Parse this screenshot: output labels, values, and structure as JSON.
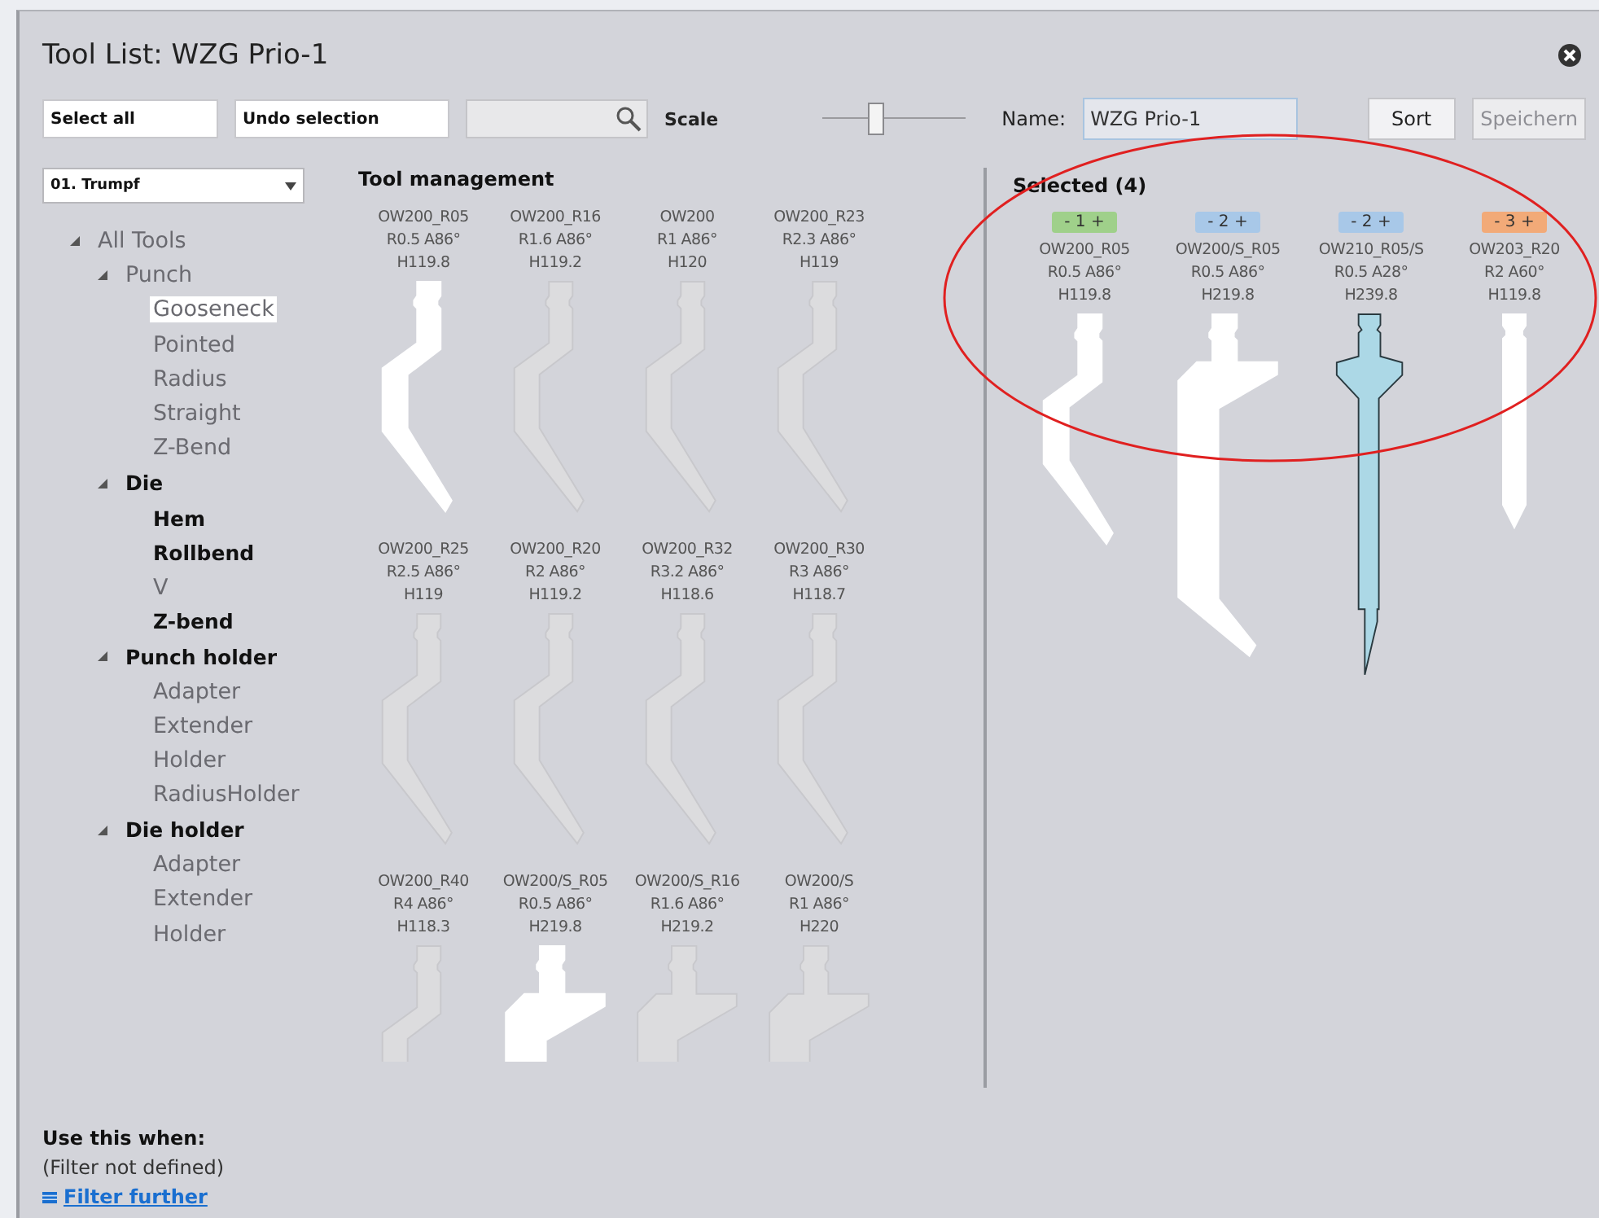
{
  "window": {
    "title": "Tool List: WZG Prio-1"
  },
  "toolbar": {
    "select_all": "Select all",
    "undo_selection": "Undo selection",
    "scale_label": "Scale",
    "scale": {
      "level": 0.37
    },
    "name_label": "Name:",
    "name_value": "WZG Prio-1",
    "sort": {
      "label": "Sort",
      "disabled": false
    },
    "save": {
      "label": "Speichern",
      "disabled": true
    }
  },
  "sidebar": {
    "dropdown": "01. Trumpf",
    "tree": [
      {
        "label": "All Tools",
        "bold": false,
        "selected": false,
        "expanded": true,
        "children": [
          {
            "label": "Punch",
            "bold": false,
            "selected": false,
            "expanded": true,
            "children": [
              {
                "label": "Gooseneck",
                "bold": false,
                "selected": true
              },
              {
                "label": "Pointed",
                "bold": false,
                "selected": false
              },
              {
                "label": "Radius",
                "bold": false,
                "selected": false
              },
              {
                "label": "Straight",
                "bold": false,
                "selected": false
              },
              {
                "label": "Z-Bend",
                "bold": false,
                "selected": false
              }
            ]
          },
          {
            "label": "Die",
            "bold": true,
            "selected": false,
            "expanded": true,
            "children": [
              {
                "label": "Hem",
                "bold": true,
                "selected": false
              },
              {
                "label": "Rollbend",
                "bold": true,
                "selected": false
              },
              {
                "label": "V",
                "bold": false,
                "selected": false
              },
              {
                "label": "Z-bend",
                "bold": true,
                "selected": false
              }
            ]
          },
          {
            "label": "Punch holder",
            "bold": true,
            "selected": false,
            "expanded": true,
            "children": [
              {
                "label": "Adapter",
                "bold": false,
                "selected": false
              },
              {
                "label": "Extender",
                "bold": false,
                "selected": false
              },
              {
                "label": "Holder",
                "bold": false,
                "selected": false
              },
              {
                "label": "RadiusHolder",
                "bold": false,
                "selected": false
              }
            ]
          },
          {
            "label": "Die holder",
            "bold": true,
            "selected": false,
            "expanded": true,
            "children": [
              {
                "label": "Adapter",
                "bold": false,
                "selected": false
              },
              {
                "label": "Extender",
                "bold": false,
                "selected": false
              },
              {
                "label": "Holder",
                "bold": false,
                "selected": false
              }
            ]
          }
        ]
      }
    ],
    "filter": {
      "heading": "Use this when:",
      "status": "(Filter not defined)",
      "link": "Filter further"
    }
  },
  "tool_management": {
    "title": "Tool management",
    "tools": [
      {
        "name": "OW200_R05",
        "spec": "R0.5  A86°",
        "height": "H119.8",
        "kind": "gooseneck",
        "selected": true
      },
      {
        "name": "OW200_R16",
        "spec": "R1.6  A86°",
        "height": "H119.2",
        "kind": "gooseneck",
        "selected": false
      },
      {
        "name": "OW200",
        "spec": "R1  A86°",
        "height": "H120",
        "kind": "gooseneck",
        "selected": false
      },
      {
        "name": "OW200_R23",
        "spec": "R2.3  A86°",
        "height": "H119",
        "kind": "gooseneck",
        "selected": false
      },
      {
        "name": "OW200_R25",
        "spec": "R2.5  A86°",
        "height": "H119",
        "kind": "gooseneck",
        "selected": false
      },
      {
        "name": "OW200_R20",
        "spec": "R2  A86°",
        "height": "H119.2",
        "kind": "gooseneck",
        "selected": false
      },
      {
        "name": "OW200_R32",
        "spec": "R3.2  A86°",
        "height": "H118.6",
        "kind": "gooseneck",
        "selected": false
      },
      {
        "name": "OW200_R30",
        "spec": "R3  A86°",
        "height": "H118.7",
        "kind": "gooseneck",
        "selected": false
      },
      {
        "name": "OW200_R40",
        "spec": "R4  A86°",
        "height": "H118.3",
        "kind": "gooseneck",
        "selected": false
      },
      {
        "name": "OW200/S_R05",
        "spec": "R0.5  A86°",
        "height": "H219.8",
        "kind": "wide",
        "selected": true
      },
      {
        "name": "OW200/S_R16",
        "spec": "R1.6  A86°",
        "height": "H219.2",
        "kind": "wide",
        "selected": false
      },
      {
        "name": "OW200/S",
        "spec": "R1  A86°",
        "height": "H220",
        "kind": "wide",
        "selected": false
      }
    ]
  },
  "selected_tools": {
    "title": "Selected (4)",
    "tools": [
      {
        "count": "- 1 +",
        "color": "#9fd08a",
        "name": "OW200_R05",
        "spec": "R0.5  A86°",
        "height": "H119.8",
        "kind": "gooseneck",
        "highlighted": false
      },
      {
        "count": "- 2 +",
        "color": "#a8c8e8",
        "name": "OW200/S_R05",
        "spec": "R0.5  A86°",
        "height": "H219.8",
        "kind": "wide",
        "highlighted": false
      },
      {
        "count": "- 2 +",
        "color": "#a8c8e8",
        "name": "OW210_R05/S",
        "spec": "R0.5  A28°",
        "height": "H239.8",
        "kind": "needle",
        "highlighted": true
      },
      {
        "count": "- 3 +",
        "color": "#f2aa78",
        "name": "OW203_R20",
        "spec": "R2  A60°",
        "height": "H119.8",
        "kind": "straight",
        "highlighted": false
      }
    ]
  }
}
